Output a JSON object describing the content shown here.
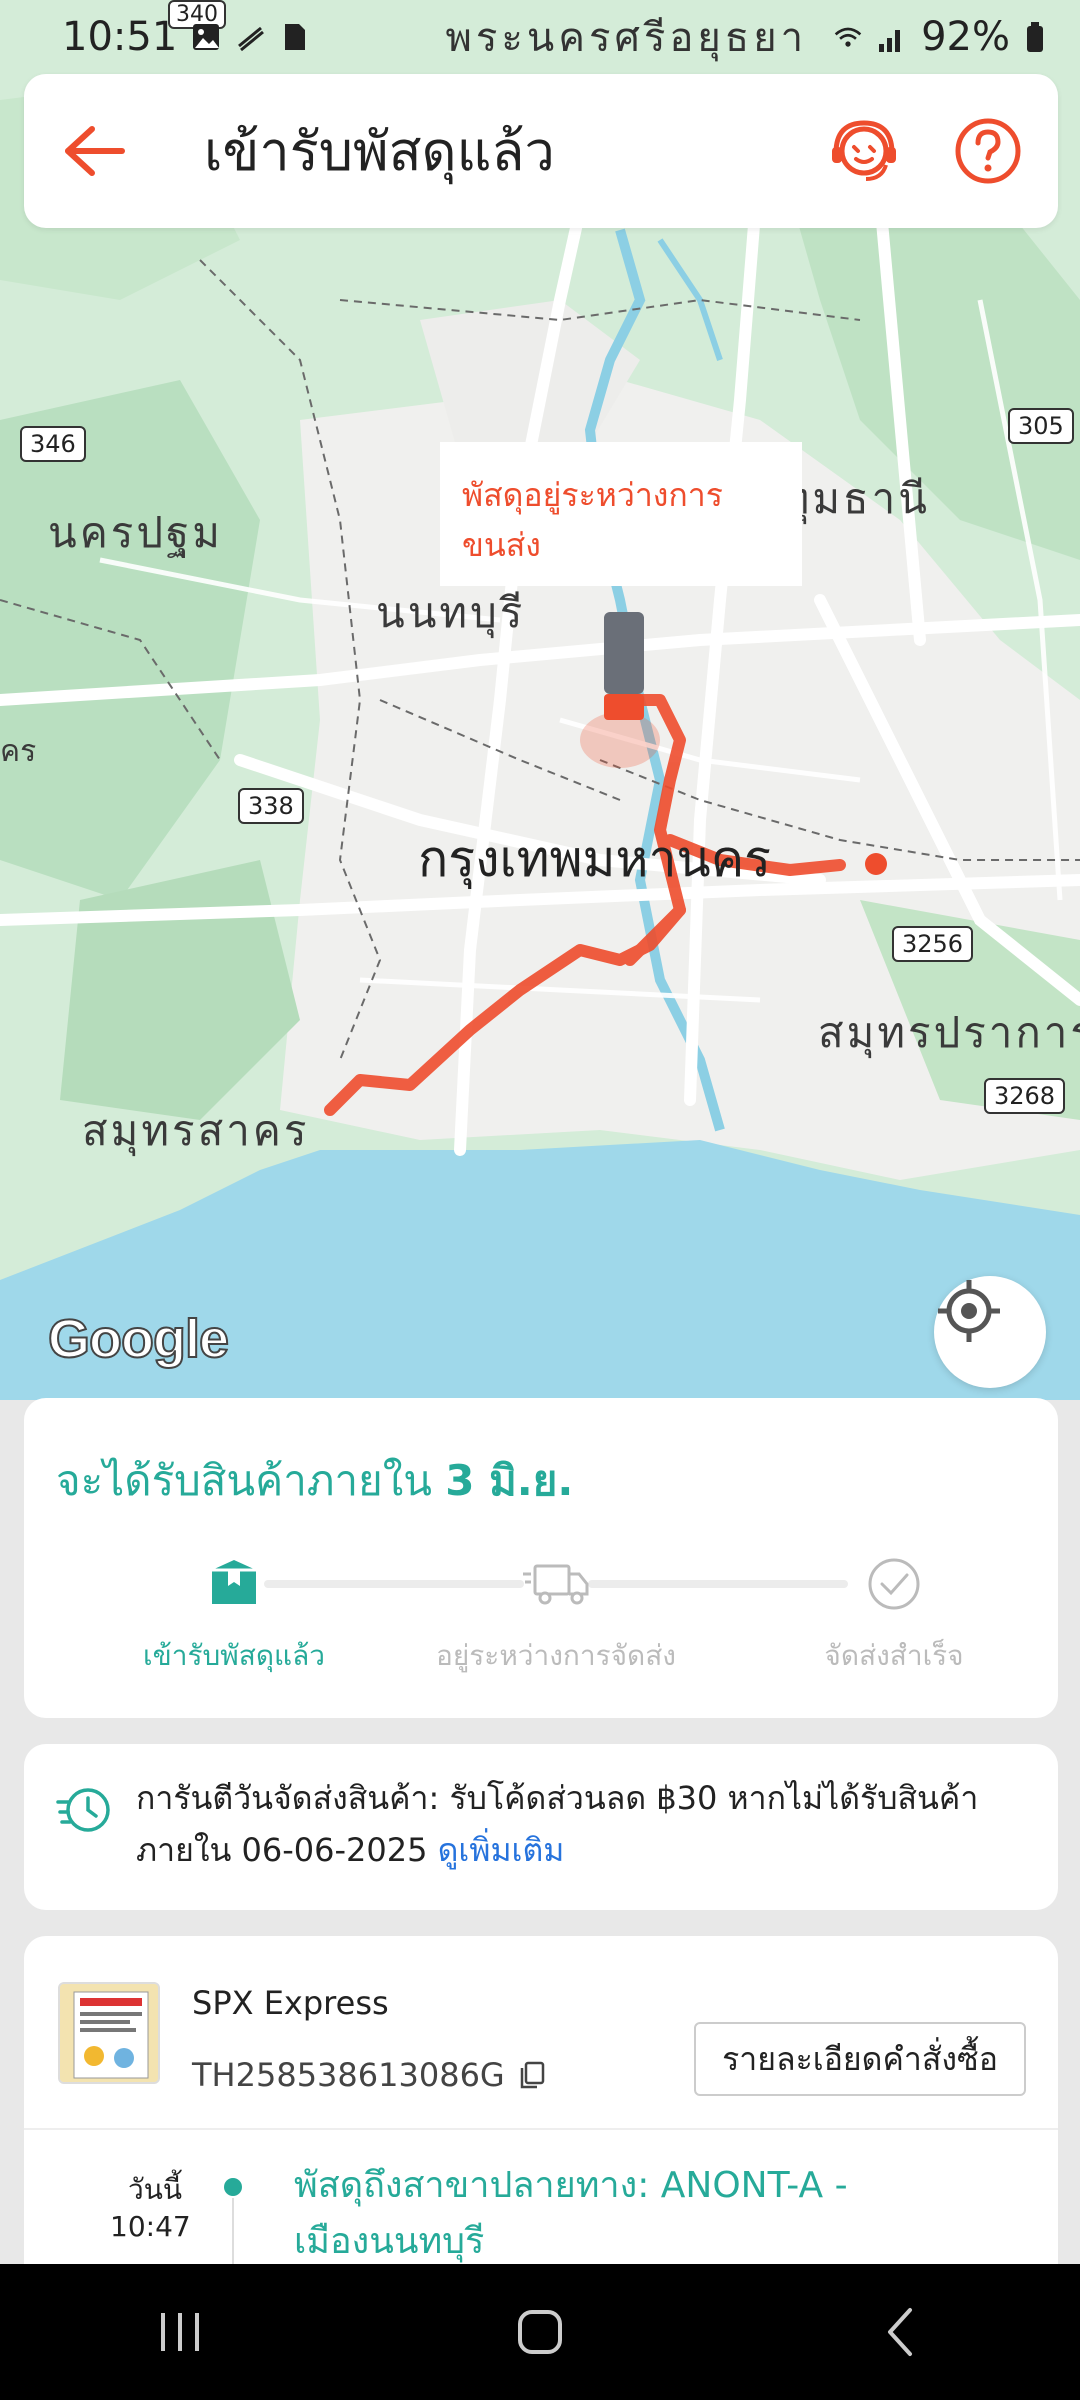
{
  "status_bar": {
    "time": "10:51",
    "location_text": "พระนครศรีอยุธยา",
    "battery": "92%"
  },
  "app_bar": {
    "title": "เข้ารับพัสดุแล้ว"
  },
  "map": {
    "tooltip": "พัสดุอยู่ระหว่างการขนส่ง",
    "labels": {
      "nonthaburi": "นนทบุรี",
      "nakhon_pathom": "นครปฐม",
      "pathum_thani": "ปทุมธานี",
      "bangkok": "กรุงเทพมหานคร",
      "samut_sakhon": "สมุทรสาคร",
      "samut_prakan": "สมุทรปราการ",
      "edge_left": "คร"
    },
    "shields": {
      "s340": "340",
      "s346": "346",
      "s305": "305",
      "s338": "338",
      "s3256": "3256",
      "s3268": "3268"
    },
    "logo": "Google"
  },
  "eta": {
    "prefix": "จะได้รับสินค้าภายใน ",
    "date": "3 มิ.ย."
  },
  "progress": {
    "steps": [
      {
        "label": "เข้ารับพัสดุแล้ว"
      },
      {
        "label": "อยู่ระหว่างการจัดส่ง"
      },
      {
        "label": "จัดส่งสำเร็จ"
      }
    ],
    "active_color": "#26aa99",
    "inactive_color": "#bbbbbb"
  },
  "guarantee": {
    "text": "การันตีวันจัดส่งสินค้า: รับโค้ดส่วนลด ฿30 หากไม่ได้รับสินค้าภายใน 06-06-2025 ",
    "link": "ดูเพิ่มเติม"
  },
  "shipment": {
    "carrier": "SPX Express",
    "tracking": "TH258538613086G",
    "order_button": "รายละเอียดคำสั่งซื้อ",
    "timeline": [
      {
        "day": "วันนี้",
        "time": "10:47",
        "event": "พัสดุถึงสาขาปลายทาง: ANONT-A - เมืองนนทบุรี"
      }
    ]
  },
  "colors": {
    "brand": "#ee4d2d",
    "teal": "#26aa99",
    "link": "#2673dd"
  }
}
